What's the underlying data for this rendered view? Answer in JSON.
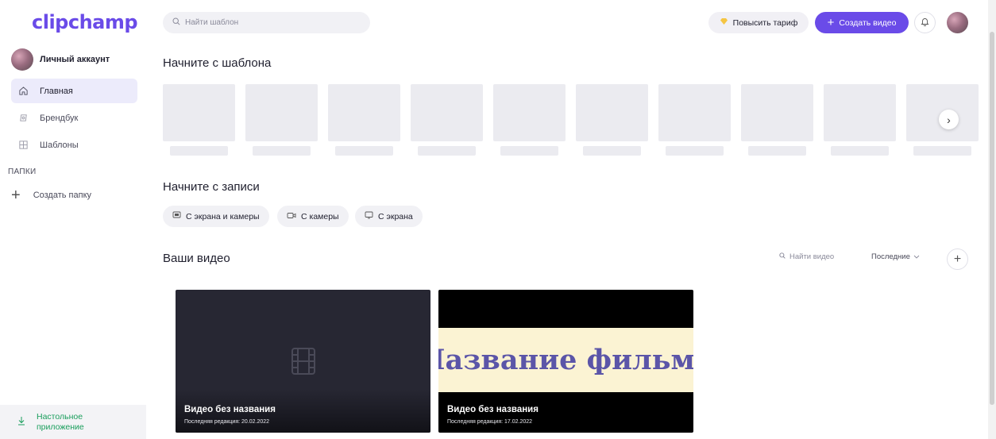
{
  "app": {
    "logo": "clipchamp"
  },
  "sidebar": {
    "account_name": "Личный аккаунт",
    "items": [
      {
        "label": "Главная",
        "icon": "home-icon",
        "active": true
      },
      {
        "label": "Брендбук",
        "icon": "brand-icon",
        "active": false
      },
      {
        "label": "Шаблоны",
        "icon": "templates-icon",
        "active": false
      }
    ],
    "folders_title": "ПАПКИ",
    "create_folder": "Создать папку",
    "desktop_app": "Настольное приложение"
  },
  "topbar": {
    "search_placeholder": "Найти шаблон",
    "upgrade_label": "Повысить тариф",
    "create_video_label": "Создать видео"
  },
  "templates": {
    "title": "Начните с шаблона",
    "count": 10
  },
  "recording": {
    "title": "Начните с записи",
    "options": [
      {
        "label": "С экрана и камеры",
        "icon": "screen-camera-icon"
      },
      {
        "label": "С камеры",
        "icon": "camera-icon"
      },
      {
        "label": "С экрана",
        "icon": "screen-icon"
      }
    ]
  },
  "videos": {
    "title": "Ваши видео",
    "search_placeholder": "Найти видео",
    "sort_label": "Последние",
    "items": [
      {
        "name": "Видео без названия",
        "date": "Последняя редакция: 20.02.2022",
        "thumbnail": "film-placeholder"
      },
      {
        "name": "Видео без названия",
        "date": "Последняя редакция: 17.02.2022",
        "thumbnail_text": "Название фильма"
      }
    ]
  },
  "colors": {
    "accent": "#6a4be8",
    "active_nav_bg": "#ecebfb",
    "desktop_link": "#1a9e5c"
  }
}
